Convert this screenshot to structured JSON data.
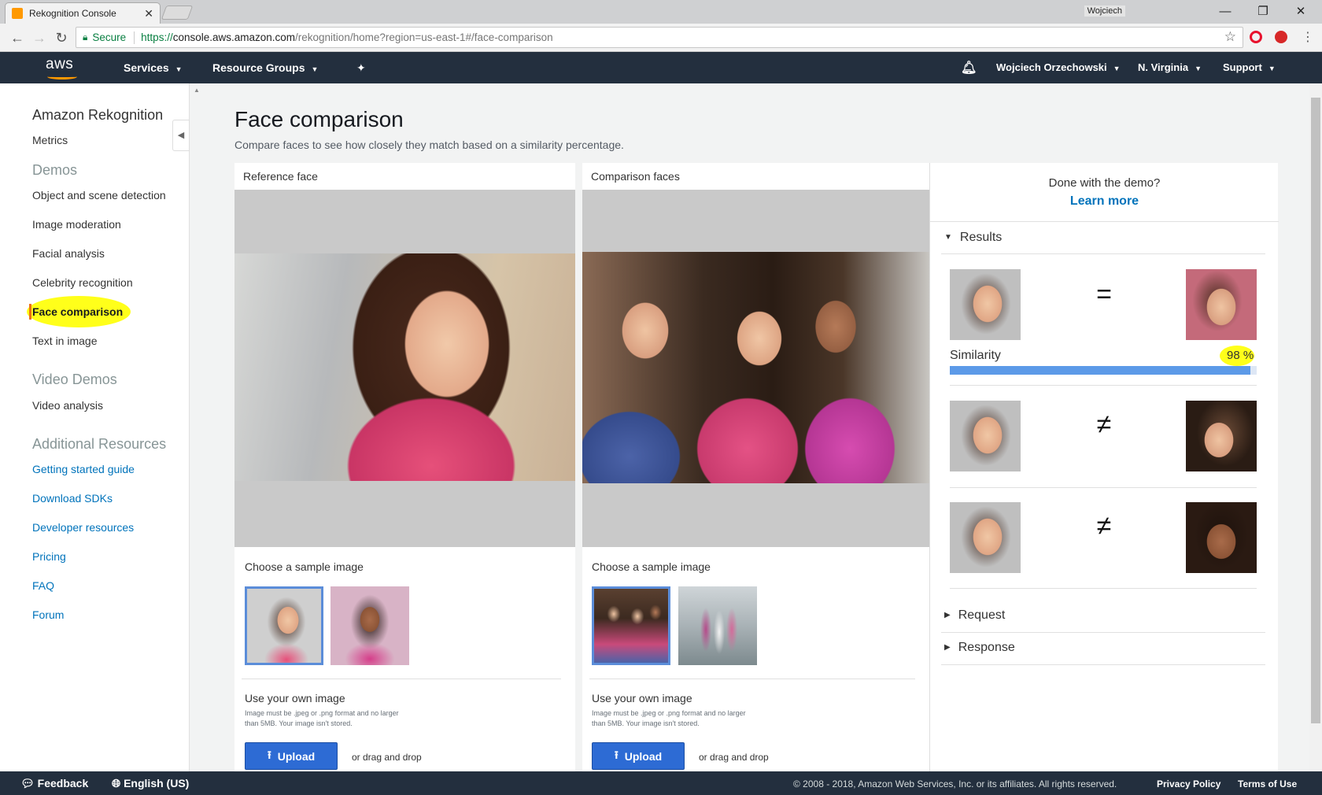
{
  "browser": {
    "tab_title": "Rekognition Console",
    "window_user": "Wojciech",
    "secure_label": "Secure",
    "url_scheme": "https://",
    "url_host": "console.aws.amazon.com",
    "url_path": "/rekognition/home?region=us-east-1#/face-comparison"
  },
  "topnav": {
    "logo": "aws",
    "services": "Services",
    "resource_groups": "Resource Groups",
    "user": "Wojciech Orzechowski",
    "region": "N. Virginia",
    "support": "Support"
  },
  "sidebar": {
    "title": "Amazon Rekognition",
    "metrics": "Metrics",
    "demos_heading": "Demos",
    "demos": [
      "Object and scene detection",
      "Image moderation",
      "Facial analysis",
      "Celebrity recognition",
      "Face comparison",
      "Text in image"
    ],
    "active_demo": "Face comparison",
    "video_heading": "Video Demos",
    "video_analysis": "Video analysis",
    "resources_heading": "Additional Resources",
    "resources": [
      "Getting started guide",
      "Download SDKs",
      "Developer resources",
      "Pricing",
      "FAQ",
      "Forum"
    ]
  },
  "main": {
    "title": "Face comparison",
    "subtitle": "Compare faces to see how closely they match based on a similarity percentage.",
    "reference_label": "Reference face",
    "comparison_label": "Comparison faces",
    "choose_sample": "Choose a sample image",
    "own_image": "Use your own image",
    "own_note": "Image must be .jpeg or .png format and no larger than 5MB. Your image isn't stored.",
    "upload": "Upload",
    "drag_drop": "or drag and drop"
  },
  "results_panel": {
    "done_text": "Done with the demo?",
    "learn_more": "Learn more",
    "results_heading": "Results",
    "similarity_label": "Similarity",
    "similarity_value": "98 %",
    "similarity": 0.98,
    "match_symbol": "=",
    "nomatch_symbol": "≠",
    "request_heading": "Request",
    "response_heading": "Response"
  },
  "footer": {
    "feedback": "Feedback",
    "language": "English (US)",
    "copyright": "© 2008 - 2018, Amazon Web Services, Inc. or its affiliates. All rights reserved.",
    "privacy": "Privacy Policy",
    "terms": "Terms of Use"
  },
  "colors": {
    "aws_nav": "#232f3e",
    "aws_orange": "#ff9900",
    "link_blue": "#0073bb",
    "highlight": "#ffff1a",
    "upload_blue": "#2d6bd4",
    "similarity_bar": "#5c9ae8"
  }
}
